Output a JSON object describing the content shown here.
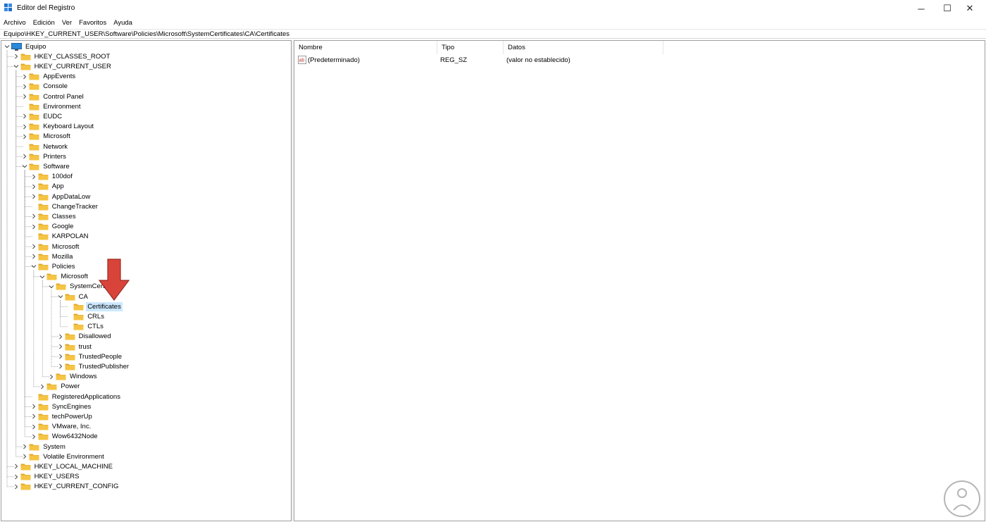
{
  "window": {
    "title": "Editor del Registro",
    "minimize": "─",
    "maximize": "☐",
    "close": "✕"
  },
  "menu": [
    "Archivo",
    "Edición",
    "Ver",
    "Favoritos",
    "Ayuda"
  ],
  "address": "Equipo\\HKEY_CURRENT_USER\\Software\\Policies\\Microsoft\\SystemCertificates\\CA\\Certificates",
  "tree": [
    {
      "label": "Equipo",
      "depth": 0,
      "exp": "v",
      "icon": "computer-icon"
    },
    {
      "label": "HKEY_CLASSES_ROOT",
      "depth": 1,
      "exp": ">"
    },
    {
      "label": "HKEY_CURRENT_USER",
      "depth": 1,
      "exp": "v"
    },
    {
      "label": "AppEvents",
      "depth": 2,
      "exp": ">"
    },
    {
      "label": "Console",
      "depth": 2,
      "exp": ">"
    },
    {
      "label": "Control Panel",
      "depth": 2,
      "exp": ">"
    },
    {
      "label": "Environment",
      "depth": 2,
      "exp": ""
    },
    {
      "label": "EUDC",
      "depth": 2,
      "exp": ">"
    },
    {
      "label": "Keyboard Layout",
      "depth": 2,
      "exp": ">"
    },
    {
      "label": "Microsoft",
      "depth": 2,
      "exp": ">"
    },
    {
      "label": "Network",
      "depth": 2,
      "exp": ""
    },
    {
      "label": "Printers",
      "depth": 2,
      "exp": ">"
    },
    {
      "label": "Software",
      "depth": 2,
      "exp": "v"
    },
    {
      "label": "100dof",
      "depth": 3,
      "exp": ">"
    },
    {
      "label": "App",
      "depth": 3,
      "exp": ">"
    },
    {
      "label": "AppDataLow",
      "depth": 3,
      "exp": ">"
    },
    {
      "label": "ChangeTracker",
      "depth": 3,
      "exp": ""
    },
    {
      "label": "Classes",
      "depth": 3,
      "exp": ">"
    },
    {
      "label": "Google",
      "depth": 3,
      "exp": ">"
    },
    {
      "label": "KARPOLAN",
      "depth": 3,
      "exp": ""
    },
    {
      "label": "Microsoft",
      "depth": 3,
      "exp": ">"
    },
    {
      "label": "Mozilla",
      "depth": 3,
      "exp": ">"
    },
    {
      "label": "Policies",
      "depth": 3,
      "exp": "v"
    },
    {
      "label": "Microsoft",
      "depth": 4,
      "exp": "v"
    },
    {
      "label": "SystemCerti",
      "depth": 5,
      "exp": "v"
    },
    {
      "label": "CA",
      "depth": 6,
      "exp": "v"
    },
    {
      "label": "Certificates",
      "depth": 7,
      "exp": "",
      "selected": true
    },
    {
      "label": "CRLs",
      "depth": 7,
      "exp": ""
    },
    {
      "label": "CTLs",
      "depth": 7,
      "exp": ""
    },
    {
      "label": "Disallowed",
      "depth": 6,
      "exp": ">"
    },
    {
      "label": "trust",
      "depth": 6,
      "exp": ">"
    },
    {
      "label": "TrustedPeople",
      "depth": 6,
      "exp": ">"
    },
    {
      "label": "TrustedPublisher",
      "depth": 6,
      "exp": ">"
    },
    {
      "label": "Windows",
      "depth": 5,
      "exp": ">"
    },
    {
      "label": "Power",
      "depth": 4,
      "exp": ">"
    },
    {
      "label": "RegisteredApplications",
      "depth": 3,
      "exp": ""
    },
    {
      "label": "SyncEngines",
      "depth": 3,
      "exp": ">"
    },
    {
      "label": "techPowerUp",
      "depth": 3,
      "exp": ">"
    },
    {
      "label": "VMware, Inc.",
      "depth": 3,
      "exp": ">"
    },
    {
      "label": "Wow6432Node",
      "depth": 3,
      "exp": ">"
    },
    {
      "label": "System",
      "depth": 2,
      "exp": ">"
    },
    {
      "label": "Volatile Environment",
      "depth": 2,
      "exp": ">"
    },
    {
      "label": "HKEY_LOCAL_MACHINE",
      "depth": 1,
      "exp": ">"
    },
    {
      "label": "HKEY_USERS",
      "depth": 1,
      "exp": ">"
    },
    {
      "label": "HKEY_CURRENT_CONFIG",
      "depth": 1,
      "exp": ">"
    }
  ],
  "list": {
    "columns": [
      "Nombre",
      "Tipo",
      "Datos"
    ],
    "rows": [
      {
        "name": "(Predeterminado)",
        "type": "REG_SZ",
        "data": "(valor no establecido)",
        "icon": "string-value-icon"
      }
    ]
  },
  "colors": {
    "folder": "#f5c444",
    "folder_dark": "#e2a72b",
    "selection": "#cce8ff",
    "arrow": "#d9443a"
  }
}
